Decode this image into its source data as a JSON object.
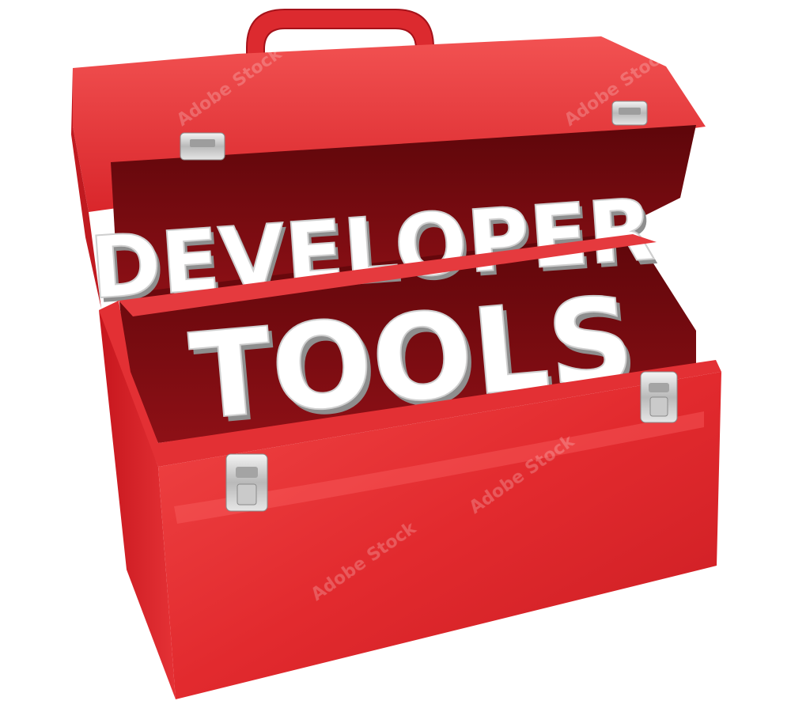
{
  "image": {
    "subject": "red-metal-toolbox",
    "headline_line1": "DEVELOPER",
    "headline_line2": "TOOLS",
    "watermark_text": "Adobe Stock",
    "colors": {
      "toolbox_red": "#e52b2b",
      "toolbox_dark_red": "#b3141c",
      "interior_dark": "#7d0a10",
      "letter_white": "#ffffff",
      "letter_shadow": "#9a9a9a",
      "latch_metal": "#d8d8d8"
    }
  }
}
